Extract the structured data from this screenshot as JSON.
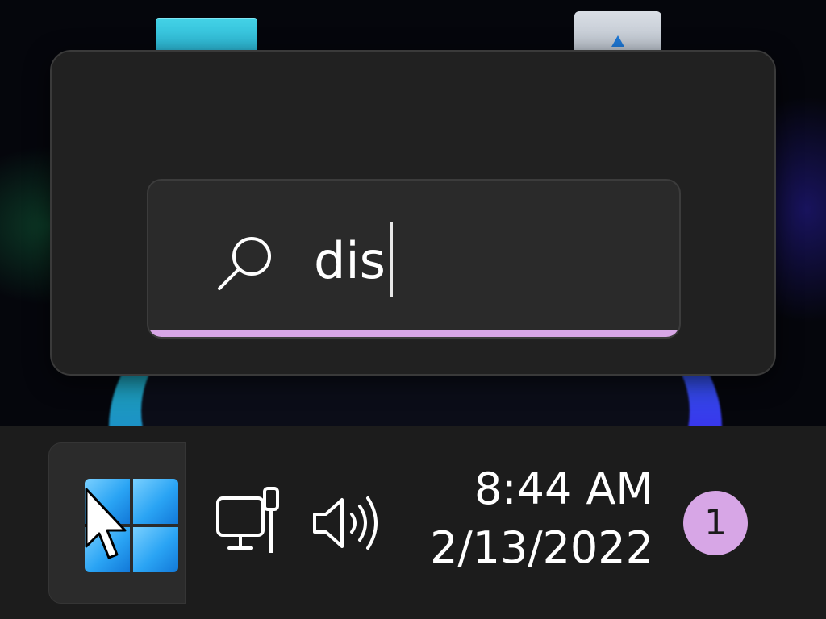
{
  "search": {
    "query": "dis",
    "icon": "search-icon"
  },
  "taskbar": {
    "start_icon": "windows-logo-icon",
    "tray": {
      "network_icon": "wired-network-icon",
      "volume_icon": "speaker-volume-icon"
    },
    "clock": {
      "time": "8:44 AM",
      "date": "2/13/2022"
    },
    "notification_count": "1"
  },
  "colors": {
    "accent": "#d7a6e6",
    "panel": "#212121",
    "taskbar": "#1c1c1c",
    "start_blue": "#2aa4f4"
  }
}
